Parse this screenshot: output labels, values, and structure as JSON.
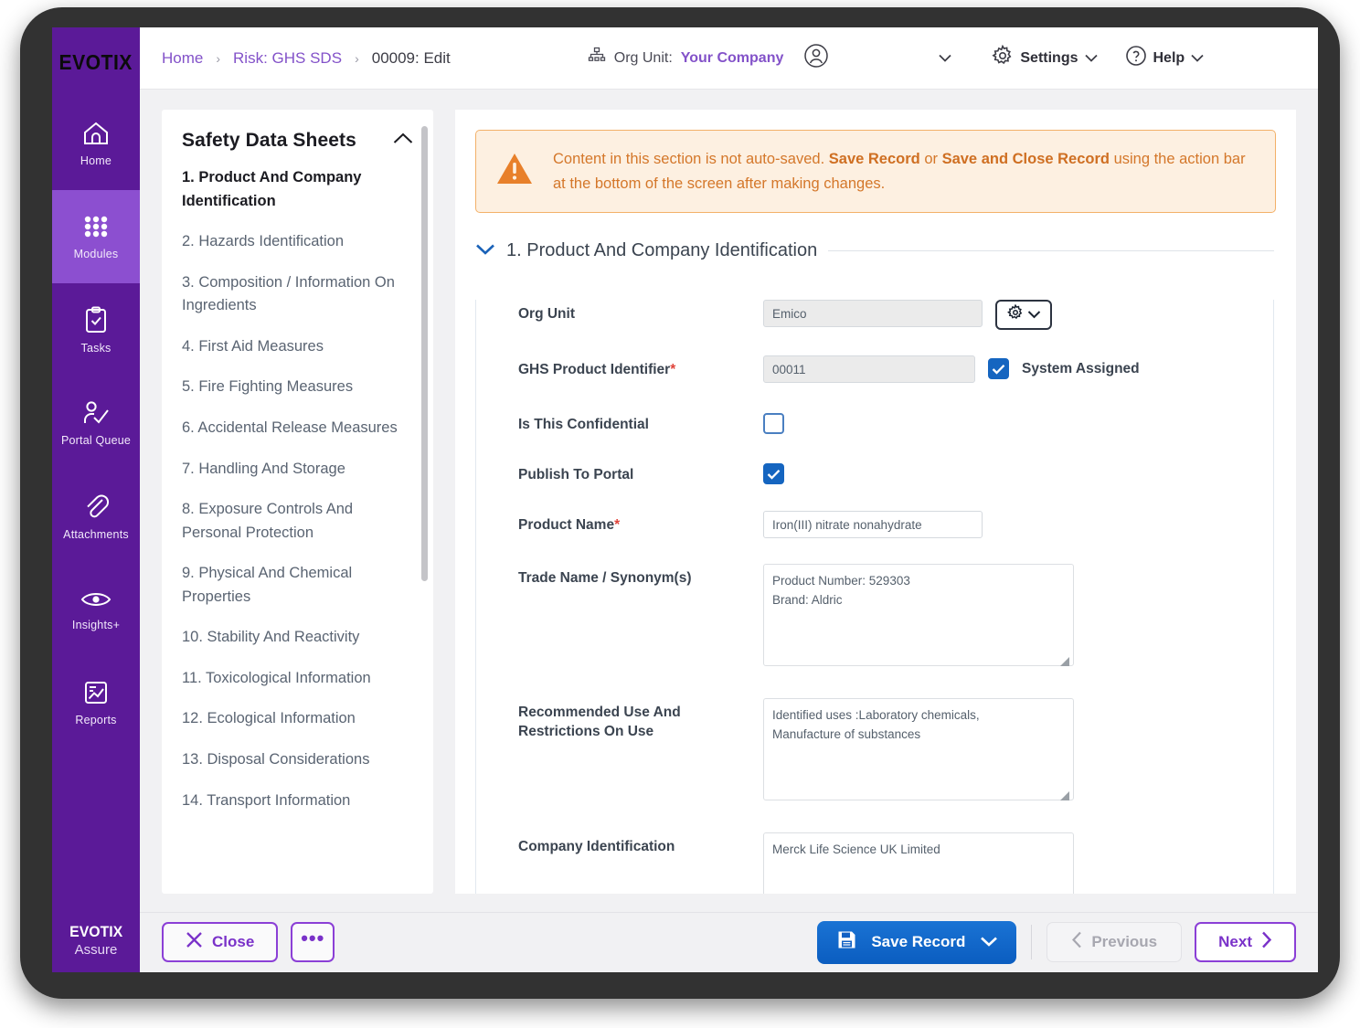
{
  "brand": {
    "logo_word": "EVOTIX",
    "footer_line1": "EVOTIX",
    "footer_line2": "Assure",
    "purple": "#5b1a98",
    "accent_purple": "#8352c9",
    "blue": "#1565c0",
    "warn_orange": "#d4772a"
  },
  "rail": {
    "items": [
      {
        "label": "Home",
        "icon": "home-icon",
        "active": false
      },
      {
        "label": "Modules",
        "icon": "grid-icon",
        "active": true
      },
      {
        "label": "Tasks",
        "icon": "clipboard-check-icon",
        "active": false
      },
      {
        "label": "Portal Queue",
        "icon": "person-check-icon",
        "active": false
      },
      {
        "label": "Attachments",
        "icon": "paperclip-icon",
        "active": false
      },
      {
        "label": "Insights+",
        "icon": "eye-icon",
        "active": false
      },
      {
        "label": "Reports",
        "icon": "report-chart-icon",
        "active": false
      }
    ]
  },
  "topbar": {
    "breadcrumbs": [
      {
        "label": "Home",
        "current": false
      },
      {
        "label": "Risk: GHS SDS",
        "current": false
      },
      {
        "label": "00009: Edit",
        "current": true
      }
    ],
    "separator": "›",
    "org_unit_label": "Org Unit:",
    "org_unit_value": "Your Company",
    "org_unit_icon": "org-chart-icon",
    "user_icon": "user-circle-icon",
    "settings_label": "Settings",
    "settings_icon": "gear-icon",
    "help_label": "Help",
    "help_icon": "question-circle-icon"
  },
  "nav": {
    "title": "Safety Data Sheets",
    "collapse_icon": "chevron-up-icon",
    "items": [
      {
        "label": "1. Product And Company Identification",
        "active": true
      },
      {
        "label": "2. Hazards Identification",
        "active": false
      },
      {
        "label": "3. Composition / Information On Ingredients",
        "active": false
      },
      {
        "label": "4. First Aid Measures",
        "active": false
      },
      {
        "label": "5. Fire Fighting Measures",
        "active": false
      },
      {
        "label": "6. Accidental Release Measures",
        "active": false
      },
      {
        "label": "7. Handling And Storage",
        "active": false
      },
      {
        "label": "8. Exposure Controls And Personal Protection",
        "active": false
      },
      {
        "label": "9. Physical And Chemical Properties",
        "active": false
      },
      {
        "label": "10. Stability And Reactivity",
        "active": false
      },
      {
        "label": "11. Toxicological Information",
        "active": false
      },
      {
        "label": "12. Ecological Information",
        "active": false
      },
      {
        "label": "13. Disposal Considerations",
        "active": false
      },
      {
        "label": "14. Transport Information",
        "active": false
      }
    ]
  },
  "warning": {
    "icon": "warning-triangle-icon",
    "part1": "Content in this section is not auto-saved. ",
    "bold1": "Save Record",
    "mid": " or ",
    "bold2": "Save and Close Record",
    "part2": " using the action bar at the bottom of the screen after making changes."
  },
  "section": {
    "title": "1. Product And Company Identification",
    "toggle_icon": "chevron-down-icon"
  },
  "form": {
    "org_unit": {
      "label": "Org Unit",
      "value": "Emico",
      "picker_icon": "gear-icon",
      "picker_chevron": "chevron-down-icon"
    },
    "ghs_product_identifier": {
      "label": "GHS Product Identifier",
      "required": "*",
      "value": "00011",
      "checkbox_label": "System Assigned",
      "checked": true
    },
    "is_confidential": {
      "label": "Is This Confidential",
      "checked": false
    },
    "publish_to_portal": {
      "label": "Publish To Portal",
      "checked": true
    },
    "product_name": {
      "label": "Product Name",
      "required": "*",
      "value": "Iron(III) nitrate nonahydrate"
    },
    "trade_name": {
      "label": "Trade Name / Synonym(s)",
      "value": "Product Number: 529303\nBrand: Aldric"
    },
    "recommended_use": {
      "label": "Recommended Use And Restrictions On Use",
      "value": "Identified uses :Laboratory chemicals,\nManufacture of substances"
    },
    "company_identification": {
      "label": "Company Identification",
      "value": "Merck Life Science UK Limited"
    }
  },
  "actionbar": {
    "close_label": "Close",
    "close_icon": "close-x-icon",
    "more_label": "•••",
    "save_label": "Save Record",
    "save_icon": "floppy-disk-icon",
    "save_chevron": "chevron-down-icon",
    "previous_label": "Previous",
    "previous_icon": "chevron-left-icon",
    "next_label": "Next",
    "next_icon": "chevron-right-icon"
  }
}
